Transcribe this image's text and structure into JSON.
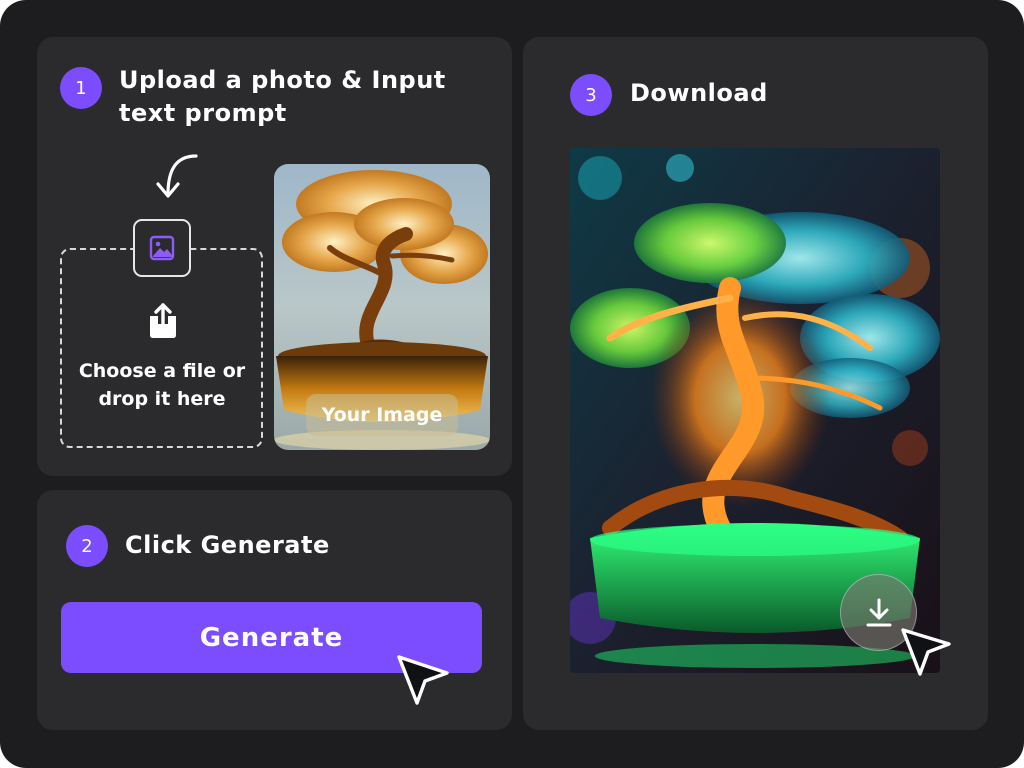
{
  "colors": {
    "background": "#1d1d1f",
    "card": "#2b2b2d",
    "accent": "#7c4dff",
    "text": "#ffffff"
  },
  "step1": {
    "number": "1",
    "title_line1": "Upload a photo & Input",
    "title_line2": "text prompt",
    "dropzone_line1": "Choose a file or",
    "dropzone_line2": "drop it here",
    "image_label": "Your Image",
    "icons": [
      "curved-arrow-down-icon",
      "image-icon",
      "upload-icon"
    ]
  },
  "step2": {
    "number": "2",
    "title": "Click Generate",
    "button_label": "Generate",
    "icons": [
      "mouse-cursor-icon"
    ]
  },
  "step3": {
    "number": "3",
    "title": "Download",
    "icons": [
      "download-icon",
      "mouse-cursor-icon"
    ]
  }
}
